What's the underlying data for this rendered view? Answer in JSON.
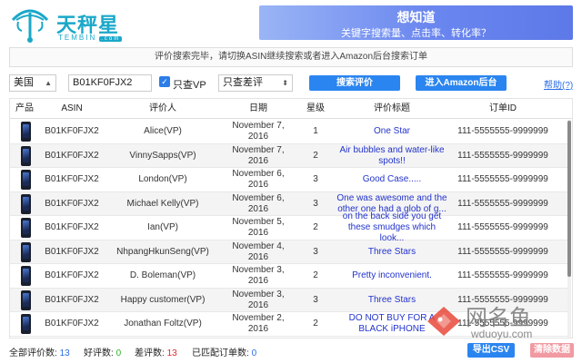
{
  "header": {
    "logo_text": "天秤星",
    "logo_sub": "TEMBIN",
    "logo_com": ".com",
    "banner_title": "想知道",
    "banner_sub": "关键字搜索量、点击率、转化率？"
  },
  "notice": "评价搜索完毕，请切换ASIN继续搜索或者进入Amazon后台搜索订单",
  "toolbar": {
    "country": "美国",
    "asin": "B01KF0FJX2",
    "vp_checked": true,
    "vp_label": "只查VP",
    "filter": "只查差评",
    "search_label": "搜索评价",
    "amazon_label": "进入Amazon后台",
    "help_label": "帮助(?)"
  },
  "table": {
    "headers": [
      "产品",
      "ASIN",
      "评价人",
      "日期",
      "星级",
      "评价标题",
      "订单ID"
    ],
    "rows": [
      {
        "asin": "B01KF0FJX2",
        "reviewer": "Alice(VP)",
        "date": "November 7, 2016",
        "stars": "1",
        "title": "One Star",
        "order": "111-5555555-9999999"
      },
      {
        "asin": "B01KF0FJX2",
        "reviewer": "VinnySapps(VP)",
        "date": "November 7, 2016",
        "stars": "2",
        "title": "Air bubbles and water-like spots!!",
        "order": "111-5555555-9999999"
      },
      {
        "asin": "B01KF0FJX2",
        "reviewer": "London(VP)",
        "date": "November 6, 2016",
        "stars": "3",
        "title": "Good Case.....",
        "order": "111-5555555-9999999"
      },
      {
        "asin": "B01KF0FJX2",
        "reviewer": "Michael Kelly(VP)",
        "date": "November 6, 2016",
        "stars": "3",
        "title": "One was awesome and the other one had a glob of g...",
        "order": "111-5555555-9999999"
      },
      {
        "asin": "B01KF0FJX2",
        "reviewer": "Ian(VP)",
        "date": "November 5, 2016",
        "stars": "2",
        "title": "on the back side you get these smudges which look...",
        "order": "111-5555555-9999999"
      },
      {
        "asin": "B01KF0FJX2",
        "reviewer": "NhpangHkunSeng(VP)",
        "date": "November 4, 2016",
        "stars": "3",
        "title": "Three Stars",
        "order": "111-5555555-9999999"
      },
      {
        "asin": "B01KF0FJX2",
        "reviewer": "D. Boleman(VP)",
        "date": "November 3, 2016",
        "stars": "2",
        "title": "Pretty inconvenient.",
        "order": "111-5555555-9999999"
      },
      {
        "asin": "B01KF0FJX2",
        "reviewer": "Happy customer(VP)",
        "date": "November 3, 2016",
        "stars": "3",
        "title": "Three Stars",
        "order": "111-5555555-9999999"
      },
      {
        "asin": "B01KF0FJX2",
        "reviewer": "Jonathan Foltz(VP)",
        "date": "November 2, 2016",
        "stars": "2",
        "title": "DO NOT BUY FOR A BLACK iPHONE",
        "order": "111-5555555-9999999"
      }
    ]
  },
  "footer": {
    "total_label": "全部评价数:",
    "total": "13",
    "good_label": "好评数:",
    "good": "0",
    "bad_label": "差评数:",
    "bad": "13",
    "matched_label": "已匹配订单数:",
    "matched": "0",
    "csv_label": "导出CSV",
    "clear_label": "清除数据"
  },
  "watermark": {
    "text": "网名鱼",
    "url": "wduoyu.com"
  },
  "colors": {
    "brand": "#1aa8c9",
    "button": "#2b85f0",
    "title_link": "#2233cc",
    "clear_button": "#f19aa2"
  }
}
